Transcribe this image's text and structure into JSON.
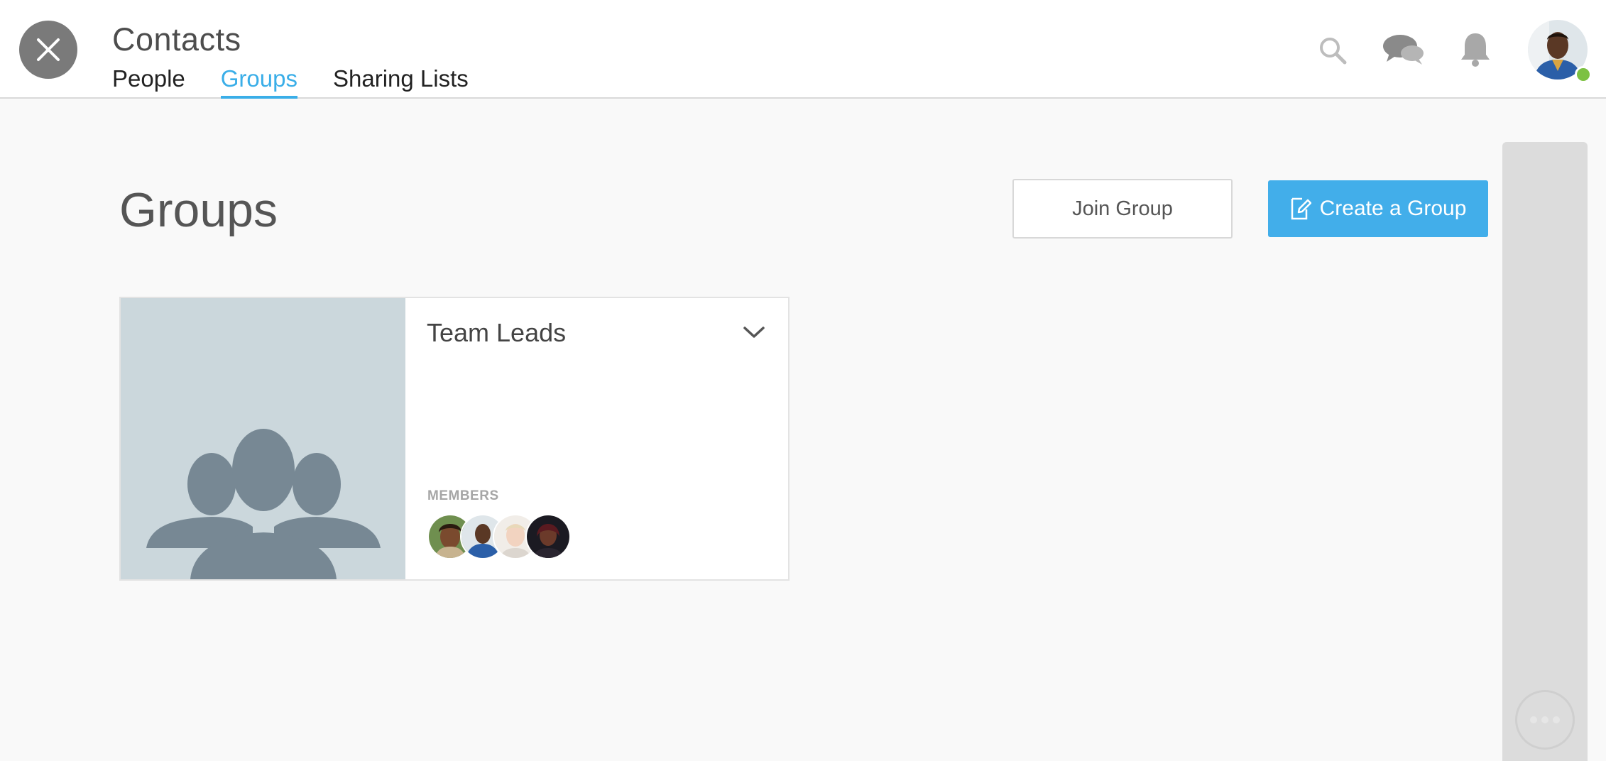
{
  "app": {
    "title": "Contacts"
  },
  "tabs": [
    {
      "label": "People",
      "active": false
    },
    {
      "label": "Groups",
      "active": true
    },
    {
      "label": "Sharing Lists",
      "active": false
    }
  ],
  "header_icons": [
    "search-icon",
    "chat-icon",
    "bell-icon"
  ],
  "page": {
    "title": "Groups",
    "join_label": "Join Group",
    "create_label": "Create a Group"
  },
  "groups": [
    {
      "name": "Team Leads",
      "members_label": "MEMBERS",
      "member_count": 4
    }
  ],
  "colors": {
    "accent": "#42aeea",
    "tab_active": "#3aaee8",
    "group_placeholder_bg": "#cbd7dc",
    "group_placeholder_fg": "#778894",
    "presence": "#7cc142"
  }
}
